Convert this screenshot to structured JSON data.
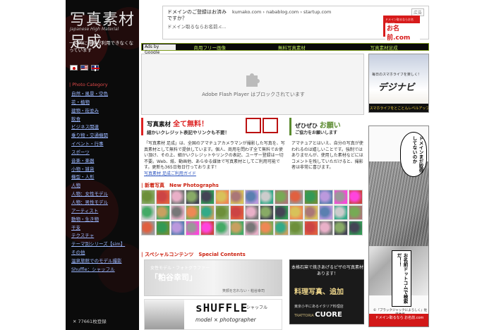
{
  "sidebar": {
    "logo_big": "写真素材 足成",
    "logo_small": "Japanese High Material",
    "notice": "一時的に検索が利用できなくなっています",
    "category_title": "| Photo Category",
    "categories": [
      "自然・風景・空色",
      "花・植物",
      "建物・街並み",
      "飲食",
      "ビジネス関連",
      "乗り物・交通機関",
      "イベント・行事",
      "スポーツ",
      "音楽・楽器",
      "小物・雑貨",
      "機型・人形",
      "人物",
      "人物：女性モデル",
      "人物：男性モデル",
      "アーティスト",
      "動物・生き物",
      "干支",
      "テクスチャ",
      "テーマ別シリーズ【sim】",
      "その他",
      "温泉旅館でのモデル撮影",
      "Shuffle：シャッフル"
    ],
    "count": "77661枚登録"
  },
  "topad": {
    "title": "ドメインのご登録はお済みですか？",
    "sub": "ドメイン取るならお名前.c...",
    "links": "kumako.com › nabablog.com › startup.com",
    "close": "広告",
    "brand_small": "ドメイン取るならお名前.com",
    "brand": "お名前.com"
  },
  "navbar": {
    "google": "Ads by Google",
    "links": [
      "商用フリー画像",
      "無料写真素材",
      "写真素材足成"
    ]
  },
  "flash": {
    "message": "Adobe Flash Player はブロックされています"
  },
  "ad1": {
    "top": "毎日のスマホライフを楽しく！",
    "brand": "デジナビ",
    "bar": "スマホライフをとことんレベルアップ"
  },
  "ad2": {
    "bubble1": "ドメインまだ取得してないのか",
    "bubble2": "お名前ドットコムで検索だ！！",
    "credit": "©『ブラックジャックによろしく』佐藤秀峰",
    "footer": "ドメイン取るなら お名前.com"
  },
  "free": {
    "l1_prefix": "写真素材 ",
    "l1_main": "全て無料！",
    "l2": "細かいクレジット表記やリンクも不要！"
  },
  "wish": {
    "l1_prefix": "ぜひぜひ ",
    "l1_main": "お願い",
    "l2": "ご協力をお願いします"
  },
  "desc": {
    "text": "「写真素材 足成」は、全国のアマチュアカメラマンが撮影した写真を、写真素材として無料で提供しています。個人、商用を問わず全て無料でお使い頂け、その上、細かいクレジットやリンクの表記、ユーザー登録は一切不要。Web、紙、動画他、あらゆる媒体で写真素材としてご利用可能です。更新も365日毎日行っております！",
    "link": "写真素材 足成ご利用ガイド"
  },
  "wishdesc": "アマチュアとはいえ、自分の写真が使われるのは嬉しいことです。強制ではありませんが、使用した素材などにはコメントを残していただけると、撮影者は非常に喜びます。",
  "new_title": "| 新着写真　New Photographs",
  "special_title": "| スペシャルコンテンツ　Special Contents",
  "banner1": {
    "n1": "女性モデル・フォトグラファー",
    "n2": "「粕谷幸司」",
    "n3": "笑顔を忘れない・粕谷幸司"
  },
  "banner2": {
    "t1": "本格石窯で焼きあげるピザの写真素材あります！",
    "t2": "料理写真、追加",
    "t3": "東京小平にあるイタリア料理店",
    "t4_prefix": "TRATTORIA ",
    "t4_name": "CUORE"
  },
  "banner3": {
    "shuffle": "sHUFFLE",
    "shuffle2": ":: シャッフル",
    "sub": "model × photographer"
  },
  "colors": {
    "accent_red": "#cc2211",
    "green": "#5a8a2e",
    "nav_green": "#b6e15a",
    "link_blue": "#9bb7ff"
  }
}
